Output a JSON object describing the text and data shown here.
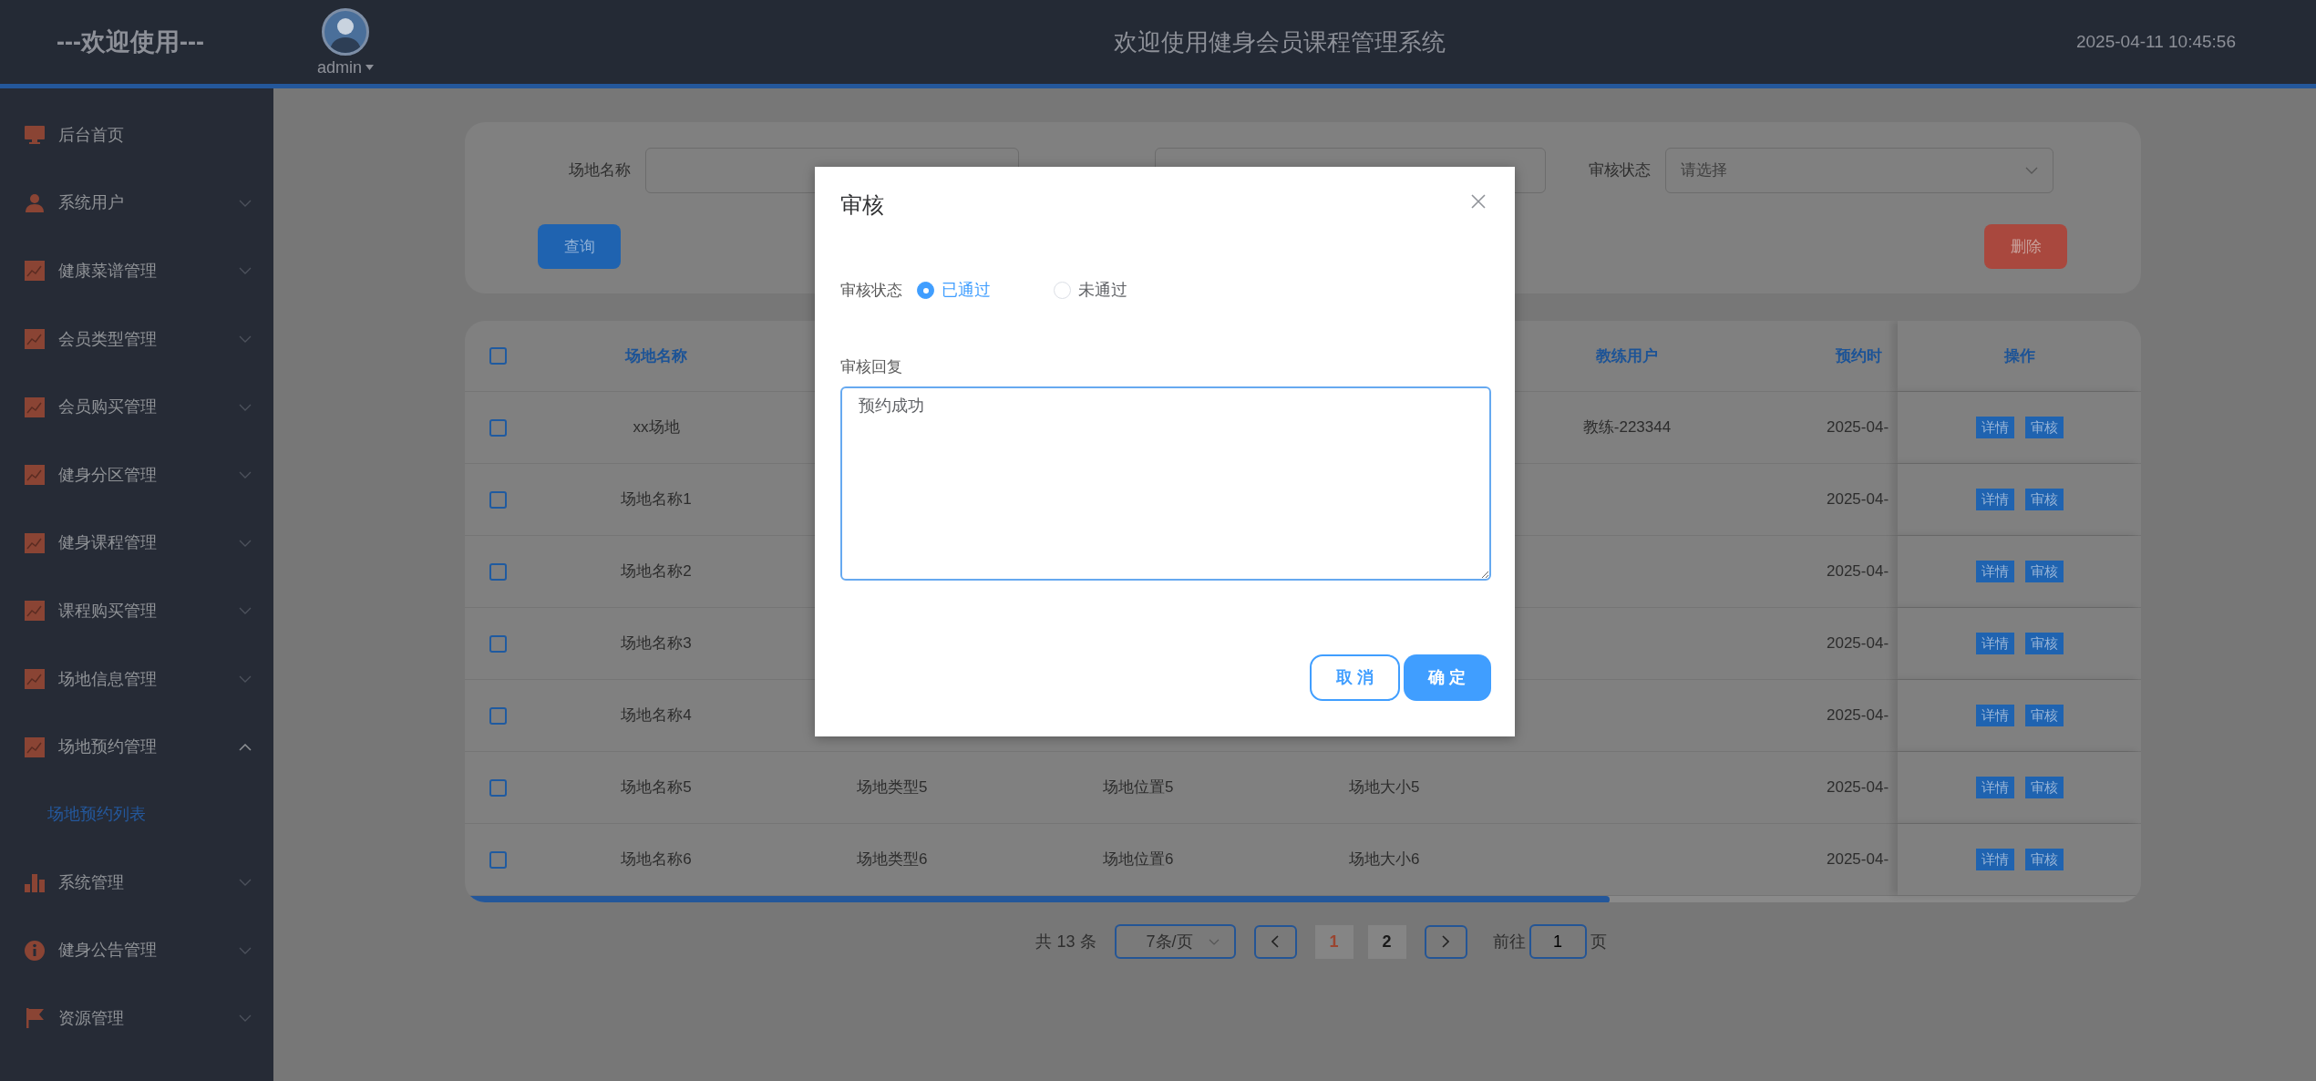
{
  "header": {
    "brand": "---欢迎使用---",
    "user": "admin",
    "title": "欢迎使用健身会员课程管理系统",
    "datetime": "2025-04-11 10:45:56"
  },
  "sidebar": {
    "items": [
      {
        "label": "后台首页",
        "kind": "link"
      },
      {
        "label": "系统用户",
        "kind": "menu",
        "expanded": false
      },
      {
        "label": "健康菜谱管理",
        "kind": "menu",
        "expanded": false
      },
      {
        "label": "会员类型管理",
        "kind": "menu",
        "expanded": false
      },
      {
        "label": "会员购买管理",
        "kind": "menu",
        "expanded": false
      },
      {
        "label": "健身分区管理",
        "kind": "menu",
        "expanded": false
      },
      {
        "label": "健身课程管理",
        "kind": "menu",
        "expanded": false
      },
      {
        "label": "课程购买管理",
        "kind": "menu",
        "expanded": false
      },
      {
        "label": "场地信息管理",
        "kind": "menu",
        "expanded": false
      },
      {
        "label": "场地预约管理",
        "kind": "menu",
        "expanded": true,
        "children": [
          {
            "label": "场地预约列表",
            "selected": true
          }
        ]
      },
      {
        "label": "系统管理",
        "kind": "menu",
        "expanded": false
      },
      {
        "label": "健身公告管理",
        "kind": "menu",
        "expanded": false
      },
      {
        "label": "资源管理",
        "kind": "menu",
        "expanded": false
      }
    ]
  },
  "search": {
    "fields": [
      {
        "kind": "text",
        "label": "场地名称"
      },
      {
        "kind": "text"
      },
      {
        "kind": "select",
        "label": "审核状态",
        "placeholder": "请选择"
      }
    ],
    "search_button": "查询",
    "delete_button": "删除"
  },
  "table": {
    "select_all_checked": false,
    "columns": {
      "name": "场地名称",
      "coach": "教练用户",
      "time": "预约时",
      "actions": "操作"
    },
    "rows": [
      {
        "checked": false,
        "name": "xx场地",
        "coach": "教练-223344",
        "time": "2025-04-",
        "actions": [
          "详情",
          "审核"
        ]
      },
      {
        "checked": false,
        "name": "场地名称1",
        "time": "2025-04-",
        "actions": [
          "详情",
          "审核"
        ]
      },
      {
        "checked": false,
        "name": "场地名称2",
        "time": "2025-04-",
        "actions": [
          "详情",
          "审核"
        ]
      },
      {
        "checked": false,
        "name": "场地名称3",
        "time": "2025-04-",
        "actions": [
          "详情",
          "审核"
        ]
      },
      {
        "checked": false,
        "name": "场地名称4",
        "time": "2025-04-",
        "actions": [
          "详情",
          "审核"
        ]
      },
      {
        "checked": false,
        "name": "场地名称5",
        "type": "场地类型5",
        "location": "场地位置5",
        "size": "场地大小5",
        "time": "2025-04-",
        "actions": [
          "详情",
          "审核"
        ]
      },
      {
        "checked": false,
        "name": "场地名称6",
        "type": "场地类型6",
        "location": "场地位置6",
        "size": "场地大小6",
        "time": "2025-04-",
        "actions": [
          "详情",
          "审核"
        ]
      }
    ]
  },
  "pagination": {
    "total": "共 13 条",
    "page_size": "7条/页",
    "pages": [
      {
        "label": "1",
        "selected": true
      },
      {
        "label": "2",
        "selected": false
      }
    ],
    "goto_label": "前往",
    "goto_value": "1",
    "goto_suffix": "页"
  },
  "dialog": {
    "title": "审核",
    "status_label": "审核状态",
    "options": [
      {
        "label": "已通过",
        "selected": true
      },
      {
        "label": "未通过",
        "selected": false
      }
    ],
    "reply_label": "审核回复",
    "reply_value": "预约成功",
    "cancel_button": "取 消",
    "confirm_button": "确 定"
  }
}
